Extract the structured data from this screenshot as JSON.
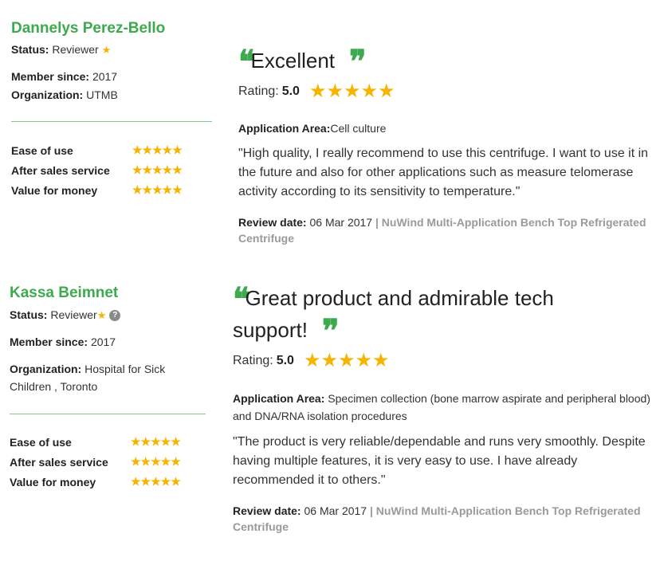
{
  "reviews": [
    {
      "reviewer_name": "Dannelys Perez-Bello",
      "status_label": "Status:",
      "status_value": "Reviewer",
      "member_since_label": "Member since:",
      "member_since_value": "2017",
      "organization_label": "Organization:",
      "organization_value": "UTMB",
      "scores": [
        {
          "label": "Ease of use",
          "stars": "★★★★★",
          "value": 5
        },
        {
          "label": "After sales service",
          "stars": "★★★★★",
          "value": 5
        },
        {
          "label": "Value for money",
          "stars": "★★★★★",
          "value": 5
        }
      ],
      "title": "Excellent",
      "rating_label": "Rating:",
      "rating_value": "5.0",
      "rating_stars": "★★★★★",
      "application_area_label": "Application Area:",
      "application_area_value": "Cell culture",
      "review_text": "\"High quality, I really recommend to use this centrifuge. I want to use it in the future and also for other applications such as measure telomerase activity according to its sensitivity to temperature.\"",
      "review_date_label": "Review date:",
      "review_date_value": "06 Mar 2017",
      "separator": "|",
      "product_name": "NuWind Multi-Application Bench Top Refrigerated Centrifuge"
    },
    {
      "reviewer_name": "Kassa Beimnet",
      "status_label": "Status:",
      "status_value": "Reviewer",
      "member_since_label": "Member since:",
      "member_since_value": "2017",
      "organization_label": "Organization:",
      "organization_value": "Hospital for Sick Children , Toronto",
      "scores": [
        {
          "label": "Ease of use",
          "stars": "★★★★★",
          "value": 5
        },
        {
          "label": "After sales service",
          "stars": "★★★★★",
          "value": 5
        },
        {
          "label": "Value for money",
          "stars": "★★★★★",
          "value": 5
        }
      ],
      "title": "Great product and admirable tech support!",
      "rating_label": "Rating:",
      "rating_value": "5.0",
      "rating_stars": "★★★★★",
      "application_area_label": "Application Area:",
      "application_area_value": "Specimen collection (bone marrow aspirate and peripheral blood) and DNA/RNA isolation procedures",
      "review_text": "\"The product is very reliable/dependable and runs very smoothly. Despite having multiple features, it is very easy to use. I have already recommended it to others.\"",
      "review_date_label": "Review date:",
      "review_date_value": "06 Mar 2017",
      "separator": "|",
      "product_name": "NuWind Multi-Application Bench Top Refrigerated Centrifuge"
    }
  ],
  "glyphs": {
    "open_quote": "❝",
    "close_quote": "❞",
    "small_star": "★",
    "help": "?"
  },
  "colors": {
    "accent_green": "#3daa4e",
    "star_gold": "#f6b300",
    "muted_gray": "#9a9a9a"
  }
}
